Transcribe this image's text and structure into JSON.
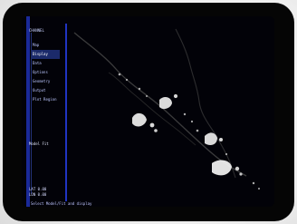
{
  "app": {
    "title": "CHANNEL",
    "status": "Model Fit",
    "footer": "Select Model/Fit and display"
  },
  "sidebar": {
    "items": [
      {
        "label": "Map"
      },
      {
        "label": "Display"
      },
      {
        "label": "Data"
      },
      {
        "label": "Options"
      },
      {
        "label": "Geometry"
      },
      {
        "label": "Output"
      },
      {
        "label": "Plot Region"
      }
    ],
    "active_index": 1
  },
  "readouts": {
    "r1": "LAT 0.00",
    "r2": "LON 0.00"
  },
  "colors": {
    "screen_bg": "#020208",
    "accent_blue": "#2b46ff",
    "text_blue": "#bcc7ff"
  },
  "icons": {
    "map_layer": "coastline-map-icon"
  }
}
